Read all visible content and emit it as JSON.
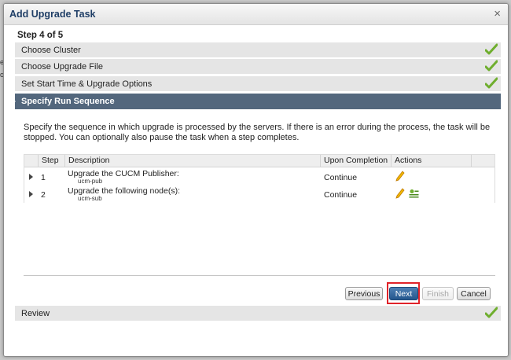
{
  "background": {
    "frag1": "e",
    "frag2": "ct"
  },
  "dialog": {
    "title": "Add Upgrade Task",
    "close": "×",
    "step_label": "Step 4 of 5",
    "steps_done": [
      {
        "label": "Choose Cluster"
      },
      {
        "label": "Choose Upgrade File"
      },
      {
        "label": "Set Start Time & Upgrade Options"
      }
    ],
    "active_step": {
      "label": "Specify Run Sequence"
    },
    "description": "Specify the sequence in which upgrade is processed by the servers. If there is an error during the process, the task will be stopped. You can optionally also pause the task when a step completes.",
    "table": {
      "headers": [
        "Step",
        "Description",
        "Upon Completion",
        "Actions"
      ],
      "rows": [
        {
          "step": "1",
          "description": "Upgrade the CUCM Publisher:",
          "node": "ucm-pub",
          "completion": "Continue"
        },
        {
          "step": "2",
          "description": "Upgrade the following node(s):",
          "node": "ucm-sub",
          "completion": "Continue"
        }
      ]
    },
    "buttons": {
      "previous": "Previous",
      "next": "Next",
      "finish": "Finish",
      "cancel": "Cancel"
    },
    "review_step": {
      "label": "Review"
    },
    "colors": {
      "accent": "#53677d",
      "primary_button": "#2f6196",
      "check": "#6fae2e",
      "highlight": "#e0232a"
    }
  }
}
